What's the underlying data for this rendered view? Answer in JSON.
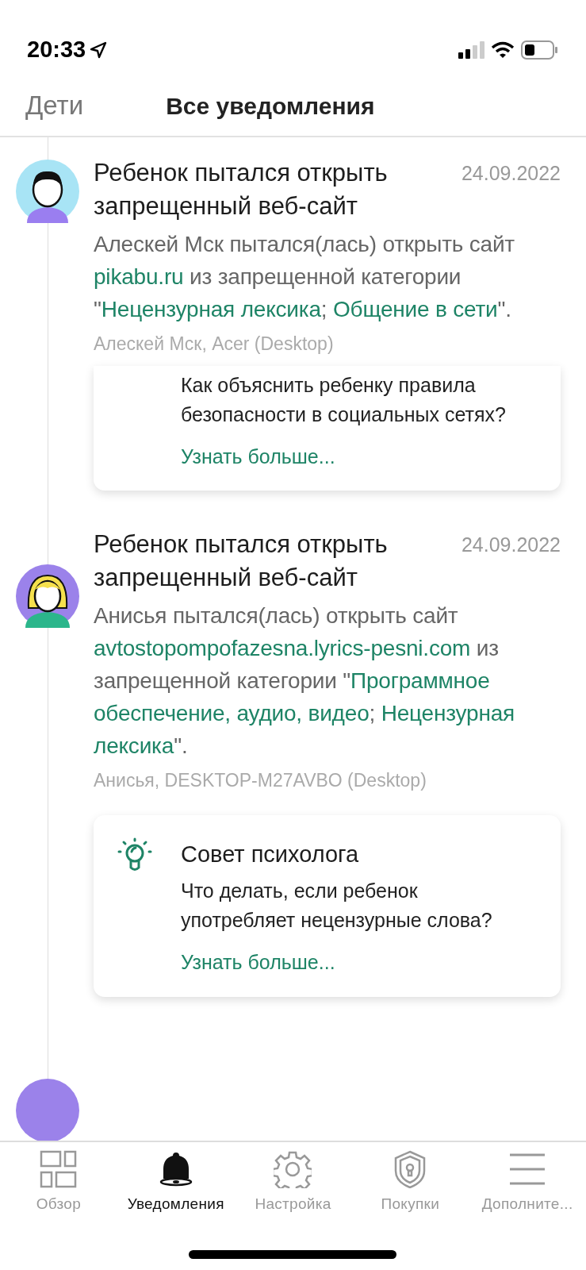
{
  "status_bar": {
    "time": "20:33"
  },
  "header": {
    "back_label": "Дети",
    "title": "Все уведомления"
  },
  "notifications": [
    {
      "color": "#a8e4f5",
      "kind": "boy",
      "title": "Ребенок пытался открыть запрещенный веб-сайт",
      "date": "24.09.2022",
      "body": [
        {
          "text": "Алеcкей Мск пытался(лась) открыть сайт ",
          "kind": "text"
        },
        {
          "text": "pikabu.ru",
          "kind": "link"
        },
        {
          "text": " из запрещенной категории \"",
          "kind": "text"
        },
        {
          "text": "Нецензурная лексика",
          "kind": "link"
        },
        {
          "text": "; ",
          "kind": "text"
        },
        {
          "text": "Общение в сети",
          "kind": "link"
        },
        {
          "text": "\".",
          "kind": "text"
        }
      ],
      "device": "Алеcкей Мск, Acer (Desktop)",
      "tip": {
        "kind": "covered",
        "text": "Как объяснить ребенку правила безопасности в социальных сетях?",
        "more": "Узнать больше..."
      }
    },
    {
      "color": "#9b82ea",
      "kind": "girl",
      "title": "Ребенок пытался открыть запрещенный веб-сайт",
      "date": "24.09.2022",
      "body": [
        {
          "text": "Анисья пытался(лась) открыть сайт ",
          "kind": "text"
        },
        {
          "text": "avtostopompofazesna.lyrics-pesni.com",
          "kind": "link"
        },
        {
          "text": " из запрещенной категории \"",
          "kind": "text"
        },
        {
          "text": "Программное",
          "kind": "link"
        },
        {
          "text": "обеспечение, аудио, видео",
          "kind": "link"
        },
        {
          "text": "; ",
          "kind": "text"
        },
        {
          "text": "Нецензурная",
          "kind": "link"
        },
        {
          "text": "лексика",
          "kind": "link"
        },
        {
          "text": "\".",
          "kind": "text"
        }
      ],
      "device": "Анисья, DESKTOP-M27AVBO (Desktop)",
      "tip": {
        "kind": "full",
        "title": "Совет психолога",
        "text": "Что делать, если ребенок употребляет нецензурные слова?",
        "more": "Узнать больше..."
      }
    },
    {
      "color": "#9b82ea",
      "kind": "cut"
    }
  ],
  "tab_bar": [
    {
      "label": "Обзор",
      "kind": "grid",
      "selected": false
    },
    {
      "label": "Уведомления",
      "kind": "bell",
      "selected": true
    },
    {
      "label": "Настройка",
      "kind": "gear",
      "selected": false
    },
    {
      "label": "Покупки",
      "kind": "shield",
      "selected": false
    },
    {
      "label": "Дополните...",
      "kind": "menu",
      "selected": false
    }
  ]
}
